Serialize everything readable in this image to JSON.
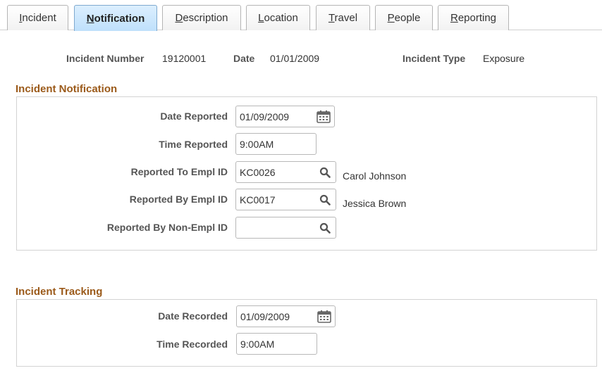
{
  "tabs": [
    {
      "label": "Incident"
    },
    {
      "label": "Notification"
    },
    {
      "label": "Description"
    },
    {
      "label": "Location"
    },
    {
      "label": "Travel"
    },
    {
      "label": "People"
    },
    {
      "label": "Reporting"
    }
  ],
  "header": {
    "incident_number_label": "Incident Number",
    "incident_number": "19120001",
    "date_label": "Date",
    "date": "01/01/2009",
    "incident_type_label": "Incident Type",
    "incident_type": "Exposure"
  },
  "notification": {
    "title": "Incident Notification",
    "date_reported_label": "Date Reported",
    "date_reported": "01/09/2009",
    "time_reported_label": "Time Reported",
    "time_reported": "9:00AM",
    "reported_to_label": "Reported To Empl ID",
    "reported_to_id": "KC0026",
    "reported_to_name": "Carol Johnson",
    "reported_by_label": "Reported By Empl ID",
    "reported_by_id": "KC0017",
    "reported_by_name": "Jessica Brown",
    "reported_by_nonempl_label": "Reported By Non-Empl ID",
    "reported_by_nonempl_id": ""
  },
  "tracking": {
    "title": "Incident Tracking",
    "date_recorded_label": "Date Recorded",
    "date_recorded": "01/09/2009",
    "time_recorded_label": "Time Recorded",
    "time_recorded": "9:00AM"
  },
  "icons": {
    "calendar": "calendar-icon",
    "lookup": "search-icon"
  },
  "colors": {
    "section_title": "#9b5a1a",
    "active_tab": "#bfe0fb"
  }
}
